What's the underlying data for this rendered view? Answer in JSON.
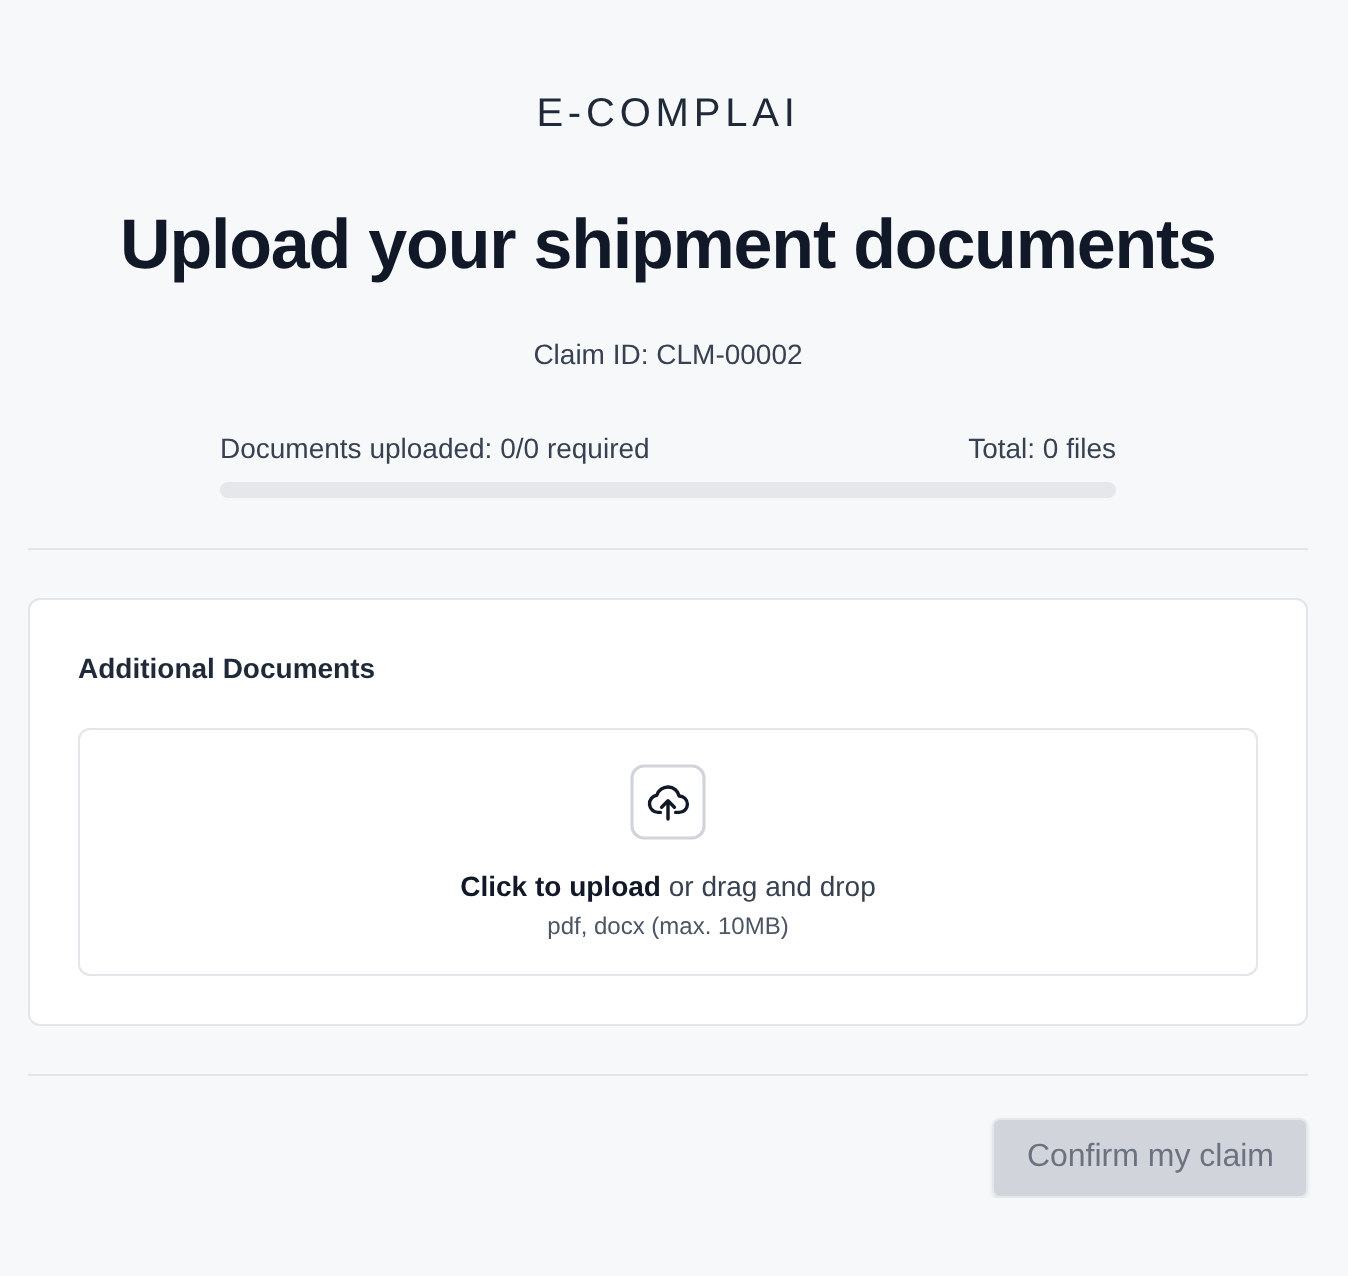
{
  "logo": {
    "text": "E-COMPLAI"
  },
  "title": "Upload your shipment documents",
  "claim_id": "Claim ID: CLM-00002",
  "progress": {
    "label": "Documents uploaded: 0/0 required",
    "total": "Total: 0 files",
    "level": 0
  },
  "sections": [
    {
      "title": "Additional Documents",
      "dropzone": {
        "prompt": "**Click to upload** or drag and drop",
        "hint": "pdf, docx (max. 10MB)"
      }
    }
  ],
  "buttons": [
    {
      "label": "Confirm my claim",
      "disabled": true
    }
  ]
}
